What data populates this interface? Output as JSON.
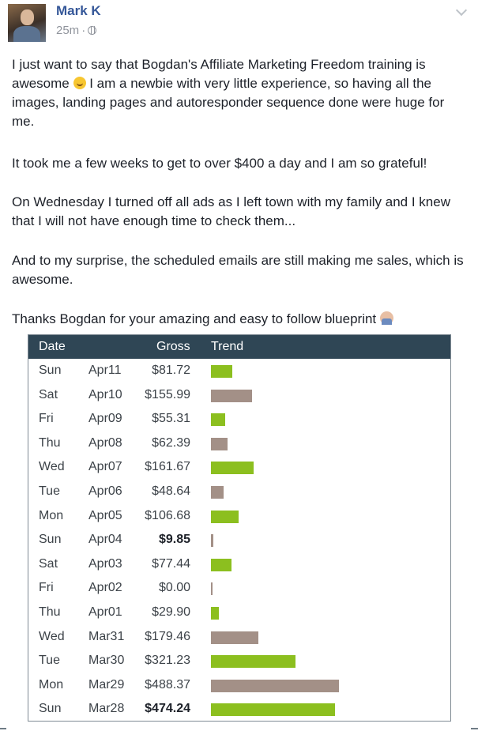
{
  "post": {
    "author": "Mark K",
    "time": "25m",
    "separator": "·",
    "paragraphs": [
      "I just want to say that Bogdan's Affiliate Marketing Freedom training is awesome",
      "I am a newbie with very little experience, so having all the images, landing pages and autoresponder sequence done were huge for me.",
      "It took me a few weeks to get to over $400 a day and I am so grateful!",
      "On Wednesday I turned off all ads as I left town with my family and I knew that I will not have enough time to check them...",
      "And to my surprise, the scheduled emails are still making me sales, which is awesome.",
      "Thanks Bogdan for your amazing and easy to follow blueprint"
    ]
  },
  "table": {
    "headers": {
      "date": "Date",
      "gross": "Gross",
      "trend": "Trend"
    },
    "colors": {
      "header_bg": "#2f4655",
      "bar_green": "#8cbf1f",
      "bar_gray": "#a39087"
    },
    "rows": [
      {
        "day": "Sun",
        "date": "Apr11",
        "gross": "$81.72",
        "value": 81.72,
        "color": "green",
        "bold": false
      },
      {
        "day": "Sat",
        "date": "Apr10",
        "gross": "$155.99",
        "value": 155.99,
        "color": "gray",
        "bold": false
      },
      {
        "day": "Fri",
        "date": "Apr09",
        "gross": "$55.31",
        "value": 55.31,
        "color": "green",
        "bold": false
      },
      {
        "day": "Thu",
        "date": "Apr08",
        "gross": "$62.39",
        "value": 62.39,
        "color": "gray",
        "bold": false
      },
      {
        "day": "Wed",
        "date": "Apr07",
        "gross": "$161.67",
        "value": 161.67,
        "color": "green",
        "bold": false
      },
      {
        "day": "Tue",
        "date": "Apr06",
        "gross": "$48.64",
        "value": 48.64,
        "color": "gray",
        "bold": false
      },
      {
        "day": "Mon",
        "date": "Apr05",
        "gross": "$106.68",
        "value": 106.68,
        "color": "green",
        "bold": false
      },
      {
        "day": "Sun",
        "date": "Apr04",
        "gross": "$9.85",
        "value": 9.85,
        "color": "gray",
        "bold": true
      },
      {
        "day": "Sat",
        "date": "Apr03",
        "gross": "$77.44",
        "value": 77.44,
        "color": "green",
        "bold": false
      },
      {
        "day": "Fri",
        "date": "Apr02",
        "gross": "$0.00",
        "value": 0.0,
        "color": "gray",
        "bold": false
      },
      {
        "day": "Thu",
        "date": "Apr01",
        "gross": "$29.90",
        "value": 29.9,
        "color": "green",
        "bold": false
      },
      {
        "day": "Wed",
        "date": "Mar31",
        "gross": "$179.46",
        "value": 179.46,
        "color": "gray",
        "bold": false
      },
      {
        "day": "Tue",
        "date": "Mar30",
        "gross": "$321.23",
        "value": 321.23,
        "color": "green",
        "bold": false
      },
      {
        "day": "Mon",
        "date": "Mar29",
        "gross": "$488.37",
        "value": 488.37,
        "color": "gray",
        "bold": false
      },
      {
        "day": "Sun",
        "date": "Mar28",
        "gross": "$474.24",
        "value": 474.24,
        "color": "green",
        "bold": true
      }
    ]
  }
}
